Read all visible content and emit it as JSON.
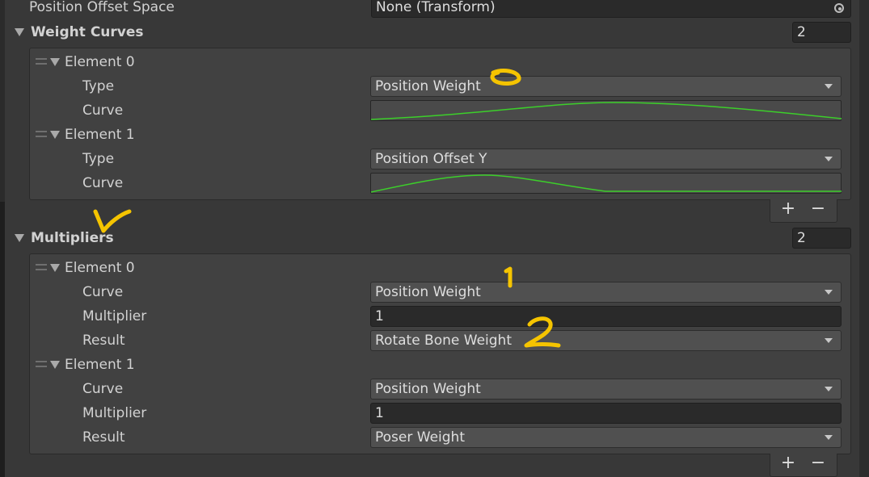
{
  "position_offset_space": {
    "label": "Position Offset Space",
    "value": "None (Transform)",
    "icon": "object-picker-icon"
  },
  "weight_curves": {
    "label": "Weight Curves",
    "count": "2",
    "elements": [
      {
        "label": "Element 0",
        "type_label": "Type",
        "type_value": "Position Weight",
        "curve_label": "Curve"
      },
      {
        "label": "Element 1",
        "type_label": "Type",
        "type_value": "Position Offset Y",
        "curve_label": "Curve"
      }
    ],
    "add": "+",
    "remove": "−"
  },
  "multipliers": {
    "label": "Multipliers",
    "count": "2",
    "elements": [
      {
        "label": "Element 0",
        "curve_label": "Curve",
        "curve_value": "Position Weight",
        "multiplier_label": "Multiplier",
        "multiplier_value": "1",
        "result_label": "Result",
        "result_value": "Rotate Bone Weight"
      },
      {
        "label": "Element 1",
        "curve_label": "Curve",
        "curve_value": "Position Weight",
        "multiplier_label": "Multiplier",
        "multiplier_value": "1",
        "result_label": "Result",
        "result_value": "Poser Weight"
      }
    ],
    "add": "+",
    "remove": "−"
  },
  "annotations": {
    "color": "#f5c400",
    "marks": [
      "0",
      "✓",
      "1",
      "2"
    ]
  },
  "colors": {
    "background": "#383838",
    "curve_line": "#3ccf2a"
  }
}
